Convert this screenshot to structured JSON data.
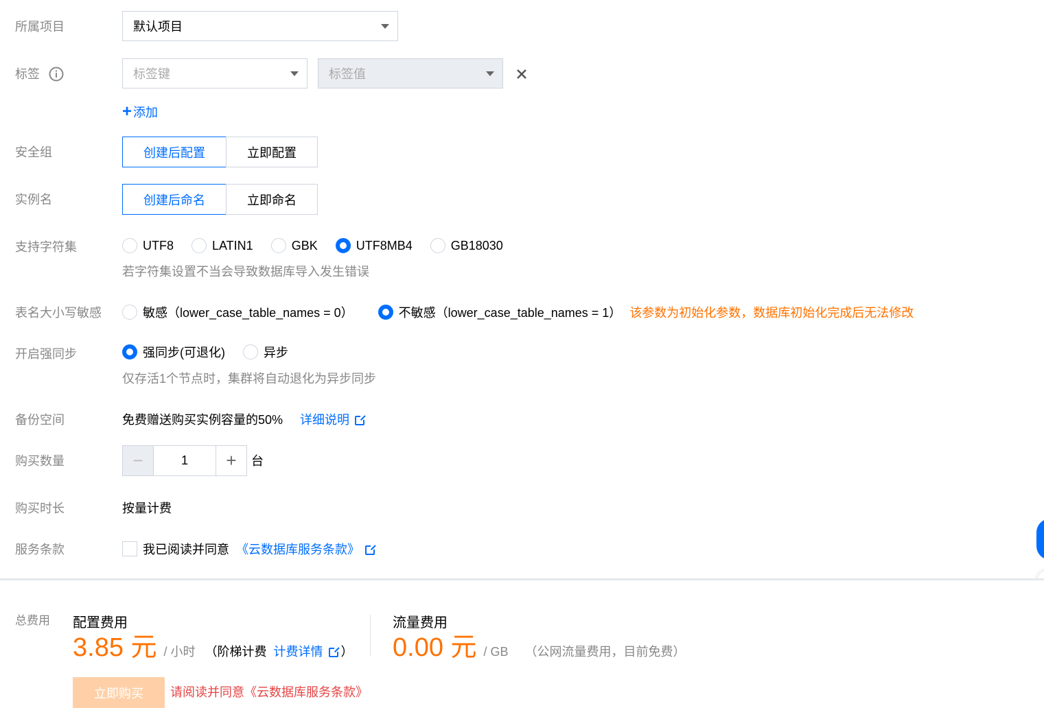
{
  "project": {
    "label": "所属项目",
    "value": "默认项目"
  },
  "tags": {
    "label": "标签",
    "key_placeholder": "标签键",
    "value_placeholder": "标签值",
    "add_label": "添加"
  },
  "security_group": {
    "label": "安全组",
    "options": [
      "创建后配置",
      "立即配置"
    ],
    "selected": "创建后配置"
  },
  "instance_name": {
    "label": "实例名",
    "options": [
      "创建后命名",
      "立即命名"
    ],
    "selected": "创建后命名"
  },
  "charset": {
    "label": "支持字符集",
    "options": [
      "UTF8",
      "LATIN1",
      "GBK",
      "UTF8MB4",
      "GB18030"
    ],
    "selected": "UTF8MB4",
    "hint": "若字符集设置不当会导致数据库导入发生错误"
  },
  "case_sensitivity": {
    "label": "表名大小写敏感",
    "options": [
      "敏感（lower_case_table_names = 0）",
      "不敏感（lower_case_table_names = 1）"
    ],
    "selected": "不敏感（lower_case_table_names = 1）",
    "warning": "该参数为初始化参数，数据库初始化完成后无法修改"
  },
  "sync": {
    "label": "开启强同步",
    "options": [
      "强同步(可退化)",
      "异步"
    ],
    "selected": "强同步(可退化)",
    "hint": "仅存活1个节点时，集群将自动退化为异步同步"
  },
  "backup": {
    "label": "备份空间",
    "text": "免费赠送购买实例容量的50%",
    "link": "详细说明"
  },
  "quantity": {
    "label": "购买数量",
    "value": "1",
    "unit": "台"
  },
  "duration": {
    "label": "购买时长",
    "value": "按量计费"
  },
  "terms": {
    "label": "服务条款",
    "text": "我已阅读并同意",
    "link": "《云数据库服务条款》"
  },
  "footer": {
    "total_label": "总费用",
    "config_title": "配置费用",
    "config_price": "3.85 元",
    "config_unit": "/ 小时",
    "config_note_open": "（阶梯计费",
    "config_note_link": "计费详情",
    "config_note_close": "）",
    "traffic_title": "流量费用",
    "traffic_price": "0.00 元",
    "traffic_unit": "/ GB",
    "traffic_note": "（公网流量费用，目前免费）",
    "buy_label": "立即购买",
    "buy_warning": "请阅读并同意《云数据库服务条款》"
  },
  "colors": {
    "accent": "#006eff",
    "price": "#ff7200",
    "warning": "#ff7200",
    "error": "#e54545"
  }
}
